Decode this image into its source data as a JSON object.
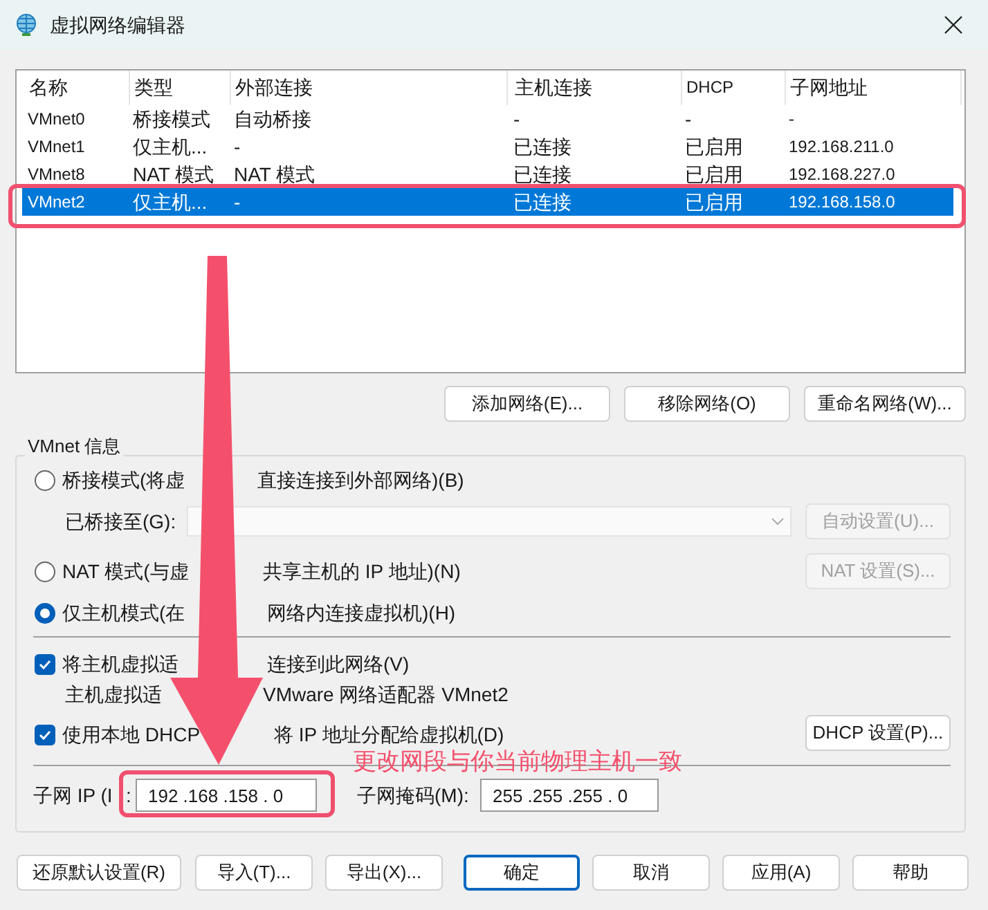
{
  "window": {
    "title": "虚拟网络编辑器"
  },
  "table": {
    "columns": [
      "名称",
      "类型",
      "外部连接",
      "主机连接",
      "DHCP",
      "子网地址"
    ],
    "rows": [
      {
        "cells": [
          "VMnet0",
          "桥接模式",
          "自动桥接",
          "-",
          "-",
          "-"
        ],
        "selected": false
      },
      {
        "cells": [
          "VMnet1",
          "仅主机...",
          "-",
          "已连接",
          "已启用",
          "192.168.211.0"
        ],
        "selected": false
      },
      {
        "cells": [
          "VMnet8",
          "NAT 模式",
          "NAT 模式",
          "已连接",
          "已启用",
          "192.168.227.0"
        ],
        "selected": false
      },
      {
        "cells": [
          "VMnet2",
          "仅主机...",
          "-",
          "已连接",
          "已启用",
          "192.168.158.0"
        ],
        "selected": true
      }
    ]
  },
  "network_buttons": [
    {
      "label": "添加网络(E)..."
    },
    {
      "label": "移除网络(O)"
    },
    {
      "label": "重命名网络(W)..."
    }
  ],
  "vmnet_info": {
    "title": "VMnet 信息",
    "modes": [
      {
        "label_parts": [
          "桥接模式(将虚",
          "直接连接到外部网络)(B)"
        ],
        "selected": false
      },
      {
        "label_parts": [
          "NAT 模式(与虚",
          "共享主机的 IP 地址)(N)"
        ],
        "selected": false
      },
      {
        "label_parts": [
          "仅主机模式(在",
          "网络内连接虚拟机)(H)"
        ],
        "selected": true
      }
    ],
    "bridged_to": {
      "label": "已桥接至(G):",
      "disabled": true
    },
    "auto_settings": {
      "label": "自动设置(U)...",
      "disabled": true
    },
    "nat_settings": {
      "label": "NAT 设置(S)...",
      "disabled": true
    },
    "connect_adapter": {
      "label_parts": [
        "将主机虚拟适",
        "连接到此网络(V)"
      ],
      "checked": true
    },
    "adapter_name": [
      "主机虚拟适",
      "VMware 网络适配器 VMnet2"
    ],
    "use_dhcp": {
      "label_parts": [
        "使用本地 DHCP",
        "将 IP 地址分配给虚拟机(D)"
      ],
      "checked": true
    },
    "dhcp_settings": {
      "label": "DHCP 设置(P)...",
      "disabled": false
    },
    "subnet_ip": {
      "label_parts": [
        "子网 IP (I",
        ":"
      ],
      "value": "192 .168 .158 . 0"
    },
    "subnet_mask": {
      "label": "子网掩码(M):",
      "value": "255 .255 .255 . 0"
    }
  },
  "annotation": {
    "note": "更改网段与你当前物理主机一致"
  },
  "footer_buttons": [
    {
      "label": "还原默认设置(R)",
      "default": false
    },
    {
      "label": "导入(T)...",
      "default": false
    },
    {
      "label": "导出(X)...",
      "default": false
    },
    {
      "label": "确定",
      "default": true
    },
    {
      "label": "取消",
      "default": false
    },
    {
      "label": "应用(A)",
      "default": false
    },
    {
      "label": "帮助",
      "default": false
    }
  ]
}
